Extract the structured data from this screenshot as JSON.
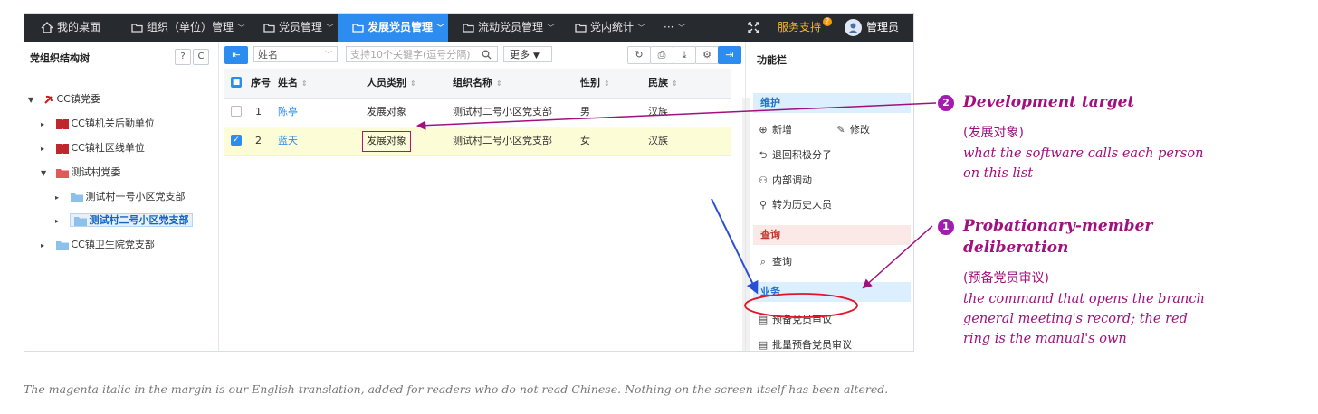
{
  "nav": {
    "items": [
      {
        "label": "我的桌面",
        "icon": "home-icon"
      },
      {
        "label": "组织（单位）管理",
        "icon": "folder-icon"
      },
      {
        "label": "党员管理",
        "icon": "folder-icon"
      },
      {
        "label": "发展党员管理",
        "icon": "folder-icon"
      },
      {
        "label": "流动党员管理",
        "icon": "folder-icon"
      },
      {
        "label": "党内统计",
        "icon": "folder-icon"
      },
      {
        "label": "···"
      }
    ],
    "service": "服务支持",
    "service_badge": "?",
    "admin": "管理员"
  },
  "tree": {
    "title": "党组织结构树",
    "buttons": [
      "?",
      "C"
    ],
    "nodes": [
      {
        "label": "CC镇党委",
        "icon": "party-emblem-icon"
      },
      {
        "label": "CC镇机关后勤单位",
        "icon": "book-icon"
      },
      {
        "label": "CC镇社区线单位",
        "icon": "book-icon"
      },
      {
        "label": "测试村党委",
        "icon": "folder-icon"
      },
      {
        "label": "测试村一号小区党支部",
        "icon": "folder-icon"
      },
      {
        "label": "测试村二号小区党支部",
        "icon": "folder-icon"
      },
      {
        "label": "CC镇卫生院党支部",
        "icon": "folder-icon"
      }
    ]
  },
  "toolbar": {
    "field_select": "姓名",
    "search_placeholder": "支持10个关键字(逗号分隔)",
    "more": "更多"
  },
  "table": {
    "columns": [
      "序号",
      "姓名",
      "人员类别",
      "组织名称",
      "性别",
      "民族"
    ],
    "rows": [
      {
        "no": "1",
        "name": "陈亭",
        "category": "发展对象",
        "org": "测试村二号小区党支部",
        "gender": "男",
        "ethnicity": "汉族",
        "checked": false
      },
      {
        "no": "2",
        "name": "蓝天",
        "category": "发展对象",
        "org": "测试村二号小区党支部",
        "gender": "女",
        "ethnicity": "汉族",
        "checked": true
      }
    ]
  },
  "func": {
    "title": "功能栏",
    "sections": [
      {
        "label": "维护",
        "items": [
          "新增",
          "修改",
          "退回积极分子",
          "内部调动",
          "转为历史人员"
        ]
      },
      {
        "label": "查询",
        "items": [
          "查询"
        ]
      },
      {
        "label": "业务",
        "items": [
          "预备党员审议",
          "批量预备党员审议"
        ]
      }
    ]
  },
  "annotations": [
    {
      "num": "2",
      "title": "Development target",
      "zh": "(发展对象)",
      "desc": [
        "what the software calls each person",
        "on this list"
      ]
    },
    {
      "num": "1",
      "title": "Probationary-member deliberation",
      "title_lines": [
        "Probationary-member",
        "deliberation"
      ],
      "zh": "(预备党员审议)",
      "desc": [
        "the command that opens the branch",
        "general meeting's record; the red",
        "ring is the manual's own"
      ]
    }
  ],
  "footnote": "The magenta italic in the margin is our English translation, added for readers who do not read Chinese. Nothing on the screen itself has been altered.",
  "colors": {
    "accent": "#2d8cf0",
    "annotation": "#a0117e",
    "ring": "#e0162b",
    "row_highlight": "#fcfcd6"
  }
}
